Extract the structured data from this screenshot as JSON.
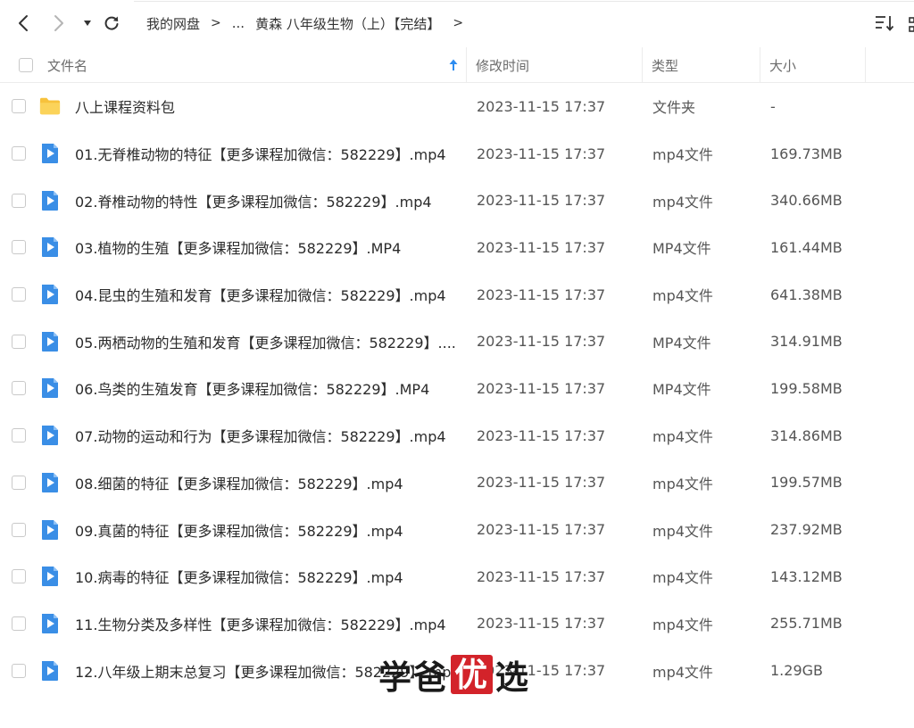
{
  "nav": {
    "breadcrumbs": [
      "我的网盘",
      "...",
      "黄森 八年级生物（上）【完结】"
    ],
    "separator": ">"
  },
  "columns": {
    "name": "文件名",
    "modified": "修改时间",
    "type": "类型",
    "size": "大小"
  },
  "colors": {
    "folder": "#f7c23c",
    "video": "#3a8ee6",
    "sort_arrow": "#2d8cf0"
  },
  "files": [
    {
      "icon": "folder-icon",
      "name": "八上课程资料包",
      "modified": "2023-11-15 17:37",
      "type": "文件夹",
      "size": "-"
    },
    {
      "icon": "video-file-icon",
      "name": "01.无脊椎动物的特征【更多课程加微信：582229】.mp4",
      "modified": "2023-11-15 17:37",
      "type": "mp4文件",
      "size": "169.73MB"
    },
    {
      "icon": "video-file-icon",
      "name": "02.脊椎动物的特性【更多课程加微信：582229】.mp4",
      "modified": "2023-11-15 17:37",
      "type": "mp4文件",
      "size": "340.66MB"
    },
    {
      "icon": "video-file-icon",
      "name": "03.植物的生殖【更多课程加微信：582229】.MP4",
      "modified": "2023-11-15 17:37",
      "type": "MP4文件",
      "size": "161.44MB"
    },
    {
      "icon": "video-file-icon",
      "name": "04.昆虫的生殖和发育【更多课程加微信：582229】.mp4",
      "modified": "2023-11-15 17:37",
      "type": "mp4文件",
      "size": "641.38MB"
    },
    {
      "icon": "video-file-icon",
      "name": "05.两栖动物的生殖和发育【更多课程加微信：582229】....",
      "modified": "2023-11-15 17:37",
      "type": "MP4文件",
      "size": "314.91MB"
    },
    {
      "icon": "video-file-icon",
      "name": "06.鸟类的生殖发育【更多课程加微信：582229】.MP4",
      "modified": "2023-11-15 17:37",
      "type": "MP4文件",
      "size": "199.58MB"
    },
    {
      "icon": "video-file-icon",
      "name": "07.动物的运动和行为【更多课程加微信：582229】.mp4",
      "modified": "2023-11-15 17:37",
      "type": "mp4文件",
      "size": "314.86MB"
    },
    {
      "icon": "video-file-icon",
      "name": "08.细菌的特征【更多课程加微信：582229】.mp4",
      "modified": "2023-11-15 17:37",
      "type": "mp4文件",
      "size": "199.57MB"
    },
    {
      "icon": "video-file-icon",
      "name": "09.真菌的特征【更多课程加微信：582229】.mp4",
      "modified": "2023-11-15 17:37",
      "type": "mp4文件",
      "size": "237.92MB"
    },
    {
      "icon": "video-file-icon",
      "name": "10.病毒的特征【更多课程加微信：582229】.mp4",
      "modified": "2023-11-15 17:37",
      "type": "mp4文件",
      "size": "143.12MB"
    },
    {
      "icon": "video-file-icon",
      "name": "11.生物分类及多样性【更多课程加微信：582229】.mp4",
      "modified": "2023-11-15 17:37",
      "type": "mp4文件",
      "size": "255.71MB"
    },
    {
      "icon": "video-file-icon",
      "name": "12.八年级上期末总复习【更多课程加微信：582229】.mp4",
      "modified": "2023-11-15 17:37",
      "type": "mp4文件",
      "size": "1.29GB"
    }
  ],
  "watermark": {
    "part1": "学爸",
    "part2": "优",
    "part3": "选",
    "color": "#d3232a"
  }
}
